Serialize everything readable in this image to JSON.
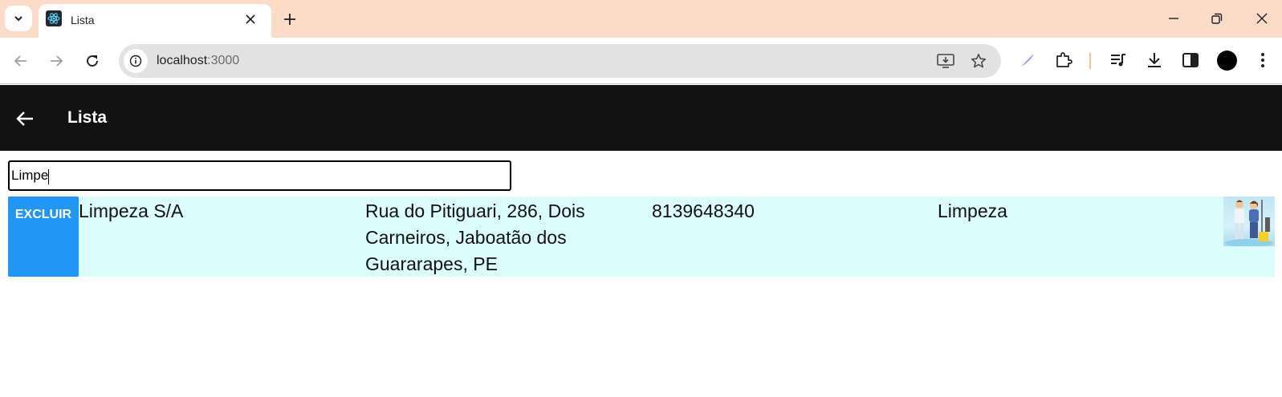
{
  "browser": {
    "tab_title": "Lista",
    "url_host": "localhost",
    "url_port": ":3000"
  },
  "app": {
    "title": "Lista",
    "search_value": "Limpe"
  },
  "rows": [
    {
      "delete_label": "EXCLUIR",
      "name": "Limpeza S/A",
      "address": "Rua do Pitiguari, 286, Dois Carneiros, Jaboatão dos Guararapes, PE",
      "phone": "8139648340",
      "category": "Limpeza",
      "image_icon": "cleaning-team-photo"
    }
  ],
  "colors": {
    "tabstrip": "#fcdcc8",
    "appbar": "#121212",
    "row_bg": "#dbfdfd",
    "delete_button": "#2196f3"
  }
}
